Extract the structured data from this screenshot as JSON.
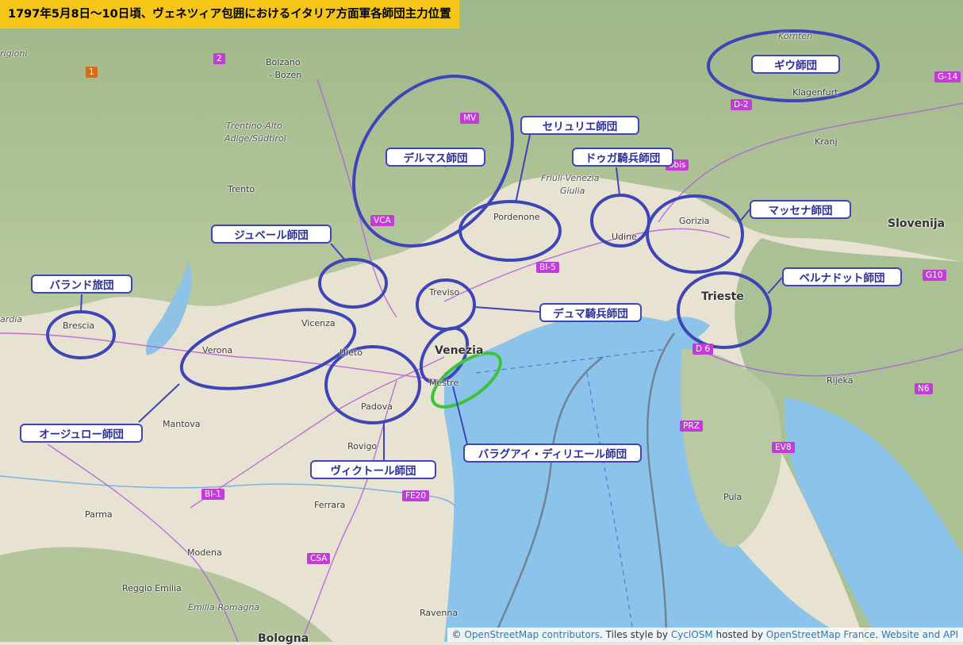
{
  "title": "1797年5月8日～10日頃、ヴェネツィア包囲におけるイタリア方面軍各師団主力位置",
  "units": {
    "giu": "ギウ師団",
    "serurier": "セリュリエ師団",
    "delmas": "デルマス師団",
    "dugua": "ドゥガ騎兵師団",
    "massena": "マッセナ師団",
    "joubert": "ジュベール師団",
    "bernadotte": "ベルナドット師団",
    "baraguey_brigade": "バランド旅団",
    "dumas": "デュマ騎兵師団",
    "augereau": "オージュロー師団",
    "victor": "ヴィクトール師団",
    "baraguey_hilliers": "バラグアイ・ディリエール師団"
  },
  "places": {
    "kornten": "Körnten",
    "klagenfurt": "Klagenfurt",
    "kranj": "Kranj",
    "bolzano": "Bolzano",
    "bozen": "- Bozen",
    "trentino": "Trentino-Alto",
    "adige": "Adige/Südtirol",
    "trento": "Trento",
    "friuli": "Friuli-Venezia",
    "giulia": "Giulia",
    "pordenone": "Pordenone",
    "udine": "Udine",
    "gorizia": "Gorizia",
    "slovenija": "Slovenija",
    "trieste": "Trieste",
    "treviso": "Treviso",
    "vicenza": "Vicenza",
    "verona": "Verona",
    "brescia": "Brescia",
    "venezia": "Venezia",
    "mestre": "Mestre",
    "padova": "Padova",
    "mantova": "Mantova",
    "rovigo": "Rovigo",
    "ferrara": "Ferrara",
    "parma": "Parma",
    "modena": "Modena",
    "reggio": "Reggio Emilia",
    "emilia": "Emilia-Romagna",
    "bologna": "Bologna",
    "ravenna": "Ravenna",
    "rijeka": "Rijeka",
    "pula": "Pula",
    "grigioni": "rigioni",
    "ardia": "ardia",
    "ulet": "Uleto"
  },
  "shields": {
    "mv": "MV",
    "vca": "VCA",
    "bi5": "BI-5",
    "d2": "D-2",
    "g14": "G-14",
    "g10": "G10",
    "d6": "D 6",
    "n6": "N6",
    "prz": "PRZ",
    "ev8": "EV8",
    "bi1": "BI-1",
    "fe20": "FE20",
    "csa": "CSA",
    "two": "2",
    "one": "1",
    "obis": "obis"
  },
  "attribution": {
    "copy": "© ",
    "osm": "OpenStreetMap contributors",
    "tiles": ". Tiles style by ",
    "cyclosm": "CyclOSM",
    "hosted": " hosted by ",
    "osmfr": "OpenStreetMap France",
    "dot": ". ",
    "website": "Website and API"
  }
}
